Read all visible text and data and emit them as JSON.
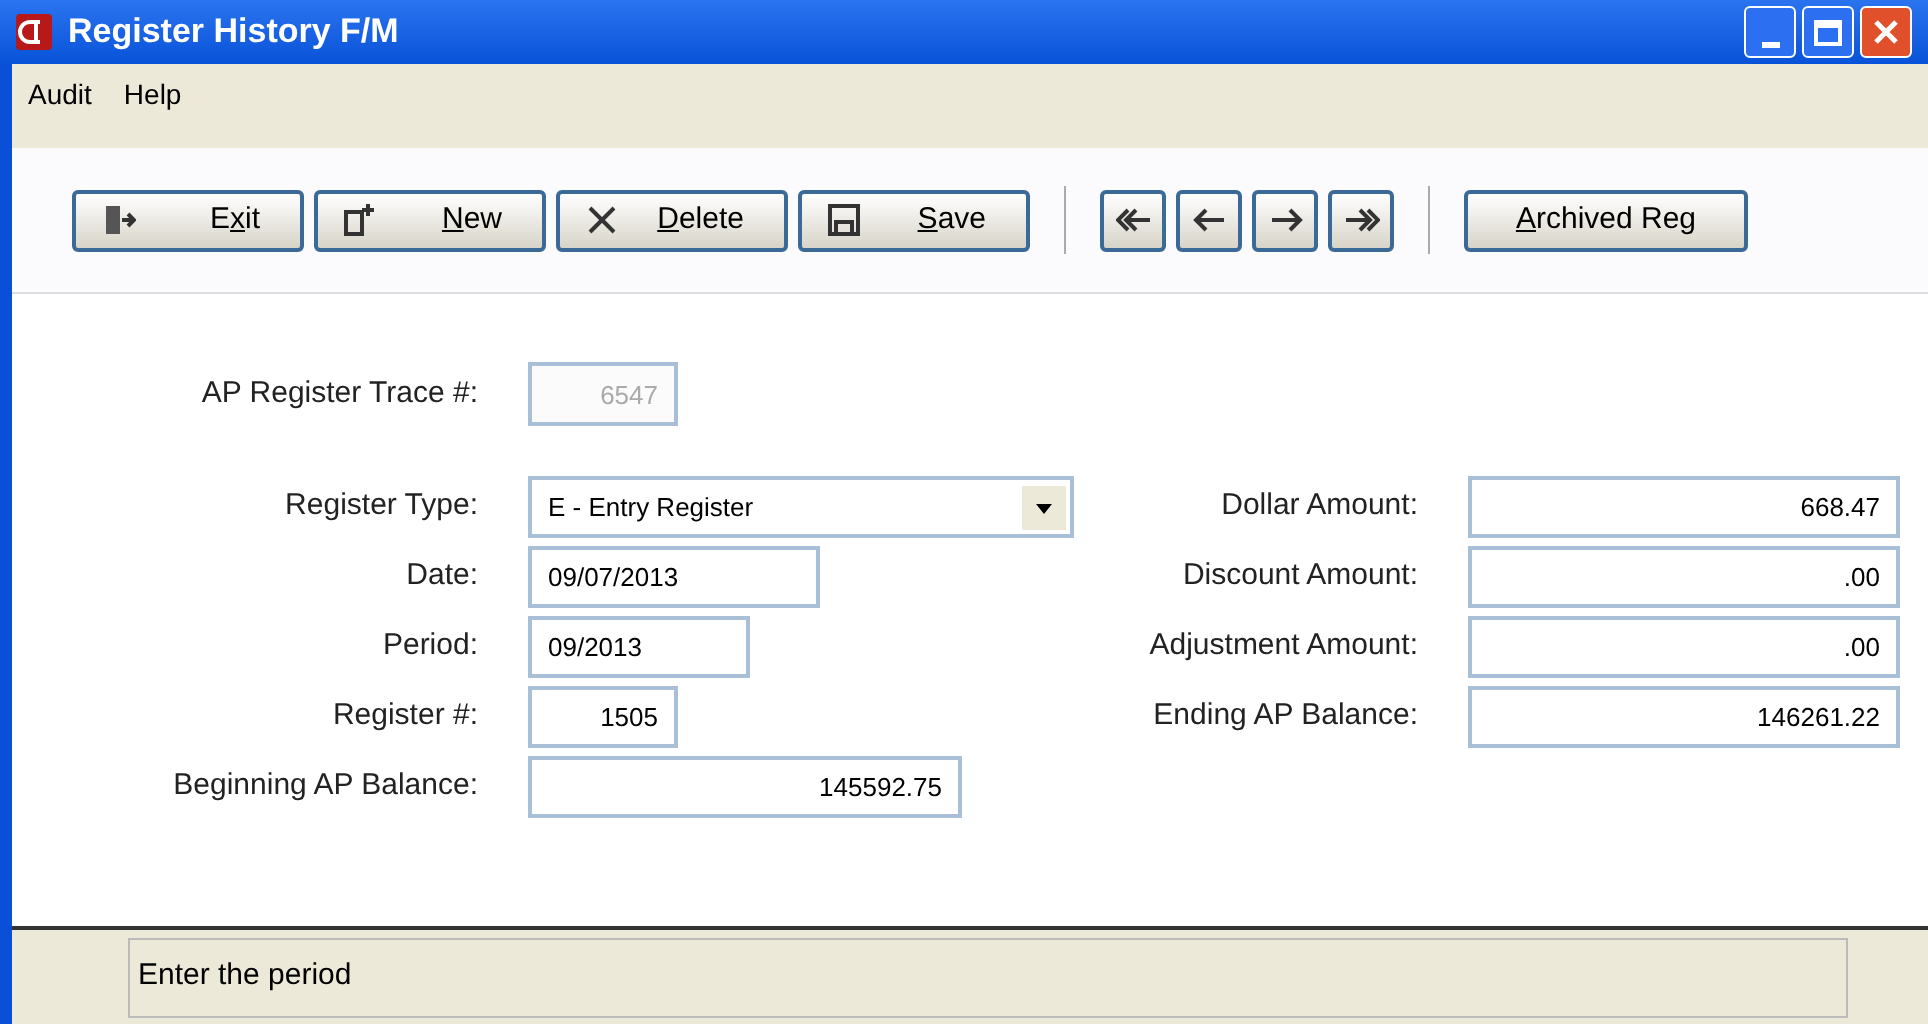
{
  "window": {
    "title": "Register History F/M"
  },
  "menu": [
    "Audit",
    "Help"
  ],
  "toolbar": [
    {
      "kind": "button",
      "label": "Exit"
    },
    {
      "kind": "button",
      "label": "New"
    },
    {
      "kind": "button",
      "label": "Delete"
    },
    {
      "kind": "button",
      "label": "Save"
    },
    {
      "kind": "separator"
    },
    {
      "kind": "nav"
    },
    {
      "kind": "nav"
    },
    {
      "kind": "nav"
    },
    {
      "kind": "nav"
    },
    {
      "kind": "separator"
    },
    {
      "kind": "text-button",
      "label": "Archived Reg"
    }
  ],
  "trace": {
    "label": "AP Register Trace #:",
    "value": "6547",
    "disabled": true
  },
  "left_fields": [
    {
      "label": "Register Type:",
      "value": "E - Entry Register",
      "kind": "dropdown"
    },
    {
      "label": "Date:",
      "value": "09/07/2013",
      "kind": "text"
    },
    {
      "label": "Period:",
      "value": "09/2013",
      "kind": "text"
    },
    {
      "label": "Register #:",
      "value": "1505",
      "kind": "text"
    },
    {
      "label": "Beginning AP Balance:",
      "value": "145592.75",
      "kind": "text"
    }
  ],
  "right_fields": [
    {
      "label": "Dollar Amount:",
      "value": "668.47"
    },
    {
      "label": "Discount Amount:",
      "value": ".00"
    },
    {
      "label": "Adjustment Amount:",
      "value": ".00"
    },
    {
      "label": "Ending AP Balance:",
      "value": "146261.22"
    }
  ],
  "status_bar": {
    "message": "Enter the period"
  }
}
